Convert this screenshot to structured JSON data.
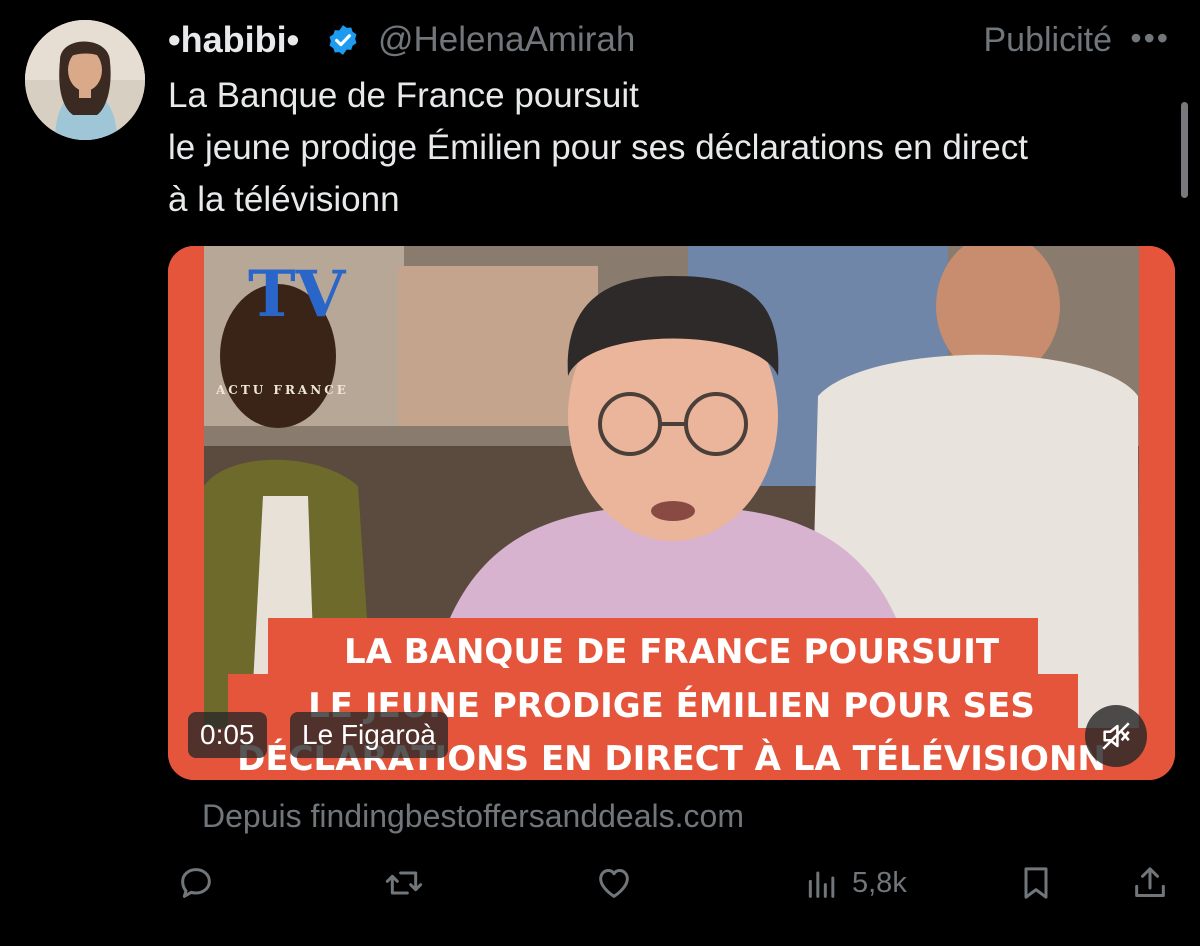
{
  "tweet": {
    "display_name": "•habibi•",
    "handle": "@HelenaAmirah",
    "promoted_label": "Publicité",
    "more_label": "•••",
    "text_lines": [
      "La Banque de France poursuit",
      "le jeune prodige Émilien pour ses déclarations en direct",
      "à la télévisionn"
    ],
    "verified": true
  },
  "media": {
    "caption_lines": [
      "LA BANQUE DE FRANCE POURSUIT",
      "LE JEUNE PRODIGE ÉMILIEN POUR SES",
      "DÉCLARATIONS EN DIRECT À LA TÉLÉVISIONN"
    ],
    "watermark_text": "ACTU FRANCE",
    "timer": "0:05",
    "label": "Le Figaroà",
    "mute_icon": "speaker-muted-icon"
  },
  "source": "Depuis findingbestoffersanddeals.com",
  "actions": {
    "reply_icon": "reply-icon",
    "retweet_icon": "retweet-icon",
    "like_icon": "heart-icon",
    "views_icon": "views-chart-icon",
    "views_count": "5,8k",
    "bookmark_icon": "bookmark-icon",
    "share_icon": "share-icon"
  },
  "colors": {
    "background": "#000000",
    "text_primary": "#e7e9ea",
    "text_secondary": "#71767b",
    "verified_blue": "#1d9bf0",
    "media_frame": "#e4553b"
  }
}
